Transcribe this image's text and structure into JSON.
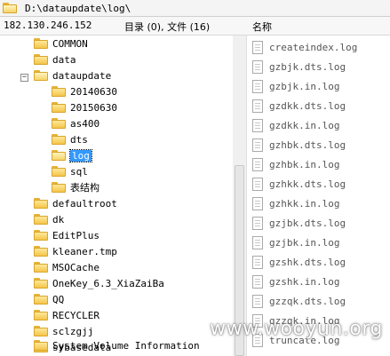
{
  "path_bar": {
    "path": "D:\\dataupdate\\log\\"
  },
  "header": {
    "address": "182.130.246.152",
    "count": "目录 (0), 文件 (16)",
    "name_column": "名称"
  },
  "tree": {
    "items": [
      {
        "label": "COMMON",
        "open": false
      },
      {
        "label": "data",
        "open": false
      },
      {
        "label": "dataupdate",
        "open": true
      },
      {
        "label": "20140630",
        "open": false
      },
      {
        "label": "20150630",
        "open": false
      },
      {
        "label": "as400",
        "open": false
      },
      {
        "label": "dts",
        "open": false
      },
      {
        "label": "log",
        "open": true,
        "selected": true
      },
      {
        "label": "sql",
        "open": false
      },
      {
        "label": "表结构",
        "open": false
      },
      {
        "label": "defaultroot",
        "open": false
      },
      {
        "label": "dk",
        "open": false
      },
      {
        "label": "EditPlus",
        "open": false
      },
      {
        "label": "kleaner.tmp",
        "open": false
      },
      {
        "label": "MSOCache",
        "open": false
      },
      {
        "label": "OneKey_6.3_XiaZaiBa",
        "open": false
      },
      {
        "label": "QQ",
        "open": false
      },
      {
        "label": "RECYCLER",
        "open": false
      },
      {
        "label": "sclzgjj",
        "open": false
      },
      {
        "label": "sybasedata",
        "open": false
      },
      {
        "label": "System Volume Information",
        "open": false
      }
    ]
  },
  "files": [
    "createindex.log",
    "gzbjk.dts.log",
    "gzbjk.in.log",
    "gzdkk.dts.log",
    "gzdkk.in.log",
    "gzhbk.dts.log",
    "gzhbk.in.log",
    "gzhkk.dts.log",
    "gzhkk.in.log",
    "gzjbk.dts.log",
    "gzjbk.in.log",
    "gzshk.dts.log",
    "gzshk.in.log",
    "gzzqk.dts.log",
    "gzzqk.in.log",
    "truncate.log"
  ],
  "watermark": "www.wooyun.org"
}
